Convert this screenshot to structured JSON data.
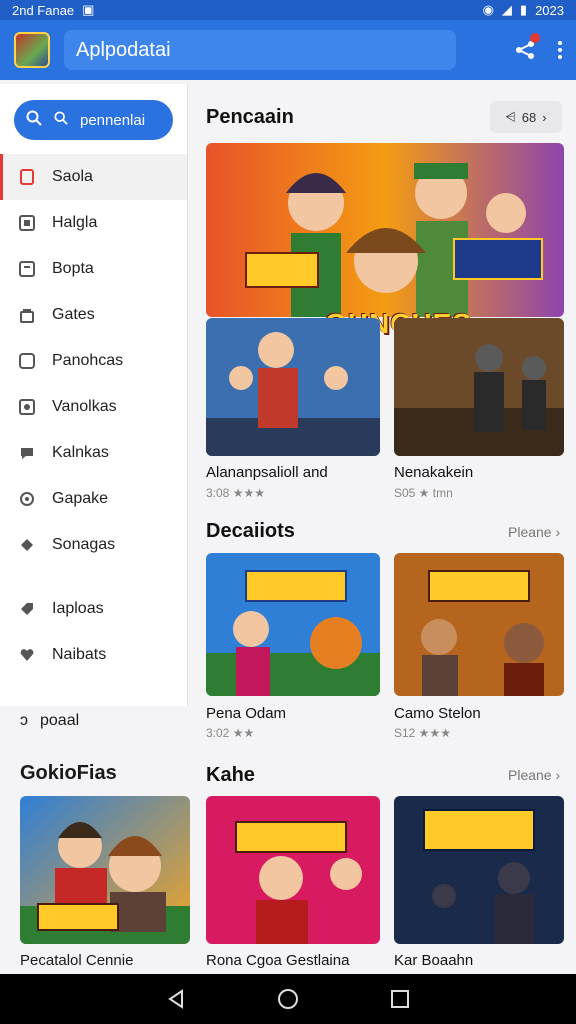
{
  "status": {
    "time": "2nd Fanae",
    "right": "2023"
  },
  "appbar": {
    "search_text": "Aplpodatai"
  },
  "sidebar": {
    "search_label": "pennenlai",
    "items": [
      {
        "label": "Saola",
        "icon": "tablet-icon"
      },
      {
        "label": "Halgla",
        "icon": "image-icon"
      },
      {
        "label": "Bopta",
        "icon": "document-icon"
      },
      {
        "label": "Gates",
        "icon": "bag-icon"
      },
      {
        "label": "Panohcas",
        "icon": "square-icon"
      },
      {
        "label": "Vanolkas",
        "icon": "gallery-icon"
      },
      {
        "label": "Kalnkas",
        "icon": "chat-icon"
      },
      {
        "label": "Gapake",
        "icon": "settings-icon"
      },
      {
        "label": "Sonagas",
        "icon": "diamond-icon"
      },
      {
        "label": "Iaploas",
        "icon": "tag-icon"
      },
      {
        "label": "Naibats",
        "icon": "heart-icon"
      }
    ],
    "extra_item": "poaal",
    "section_title": "GokioFias",
    "card_name": "Pecatalol Cennie"
  },
  "main": {
    "top_title": "Pencaain",
    "pill_label": "68",
    "banner_text": "GHNCHES",
    "top_games": [
      {
        "name": "Alananpsalioll and",
        "rating": "3:08 ★★★"
      },
      {
        "name": "Nenakakein",
        "rating": "S05 ★ tmn"
      }
    ],
    "section2_title": "Decaiiots",
    "section2_more": "Pleane",
    "section2_games": [
      {
        "name": "Pena Odam",
        "rating": "3:02 ★★"
      },
      {
        "name": "Camo Stelon",
        "rating": "S12 ★★★"
      }
    ],
    "section3_title": "Kahe",
    "section3_more": "Pleane",
    "section3_games": [
      {
        "name": "Rona Cgoa Gestlaina"
      },
      {
        "name": "Kar Boaahn"
      }
    ]
  }
}
